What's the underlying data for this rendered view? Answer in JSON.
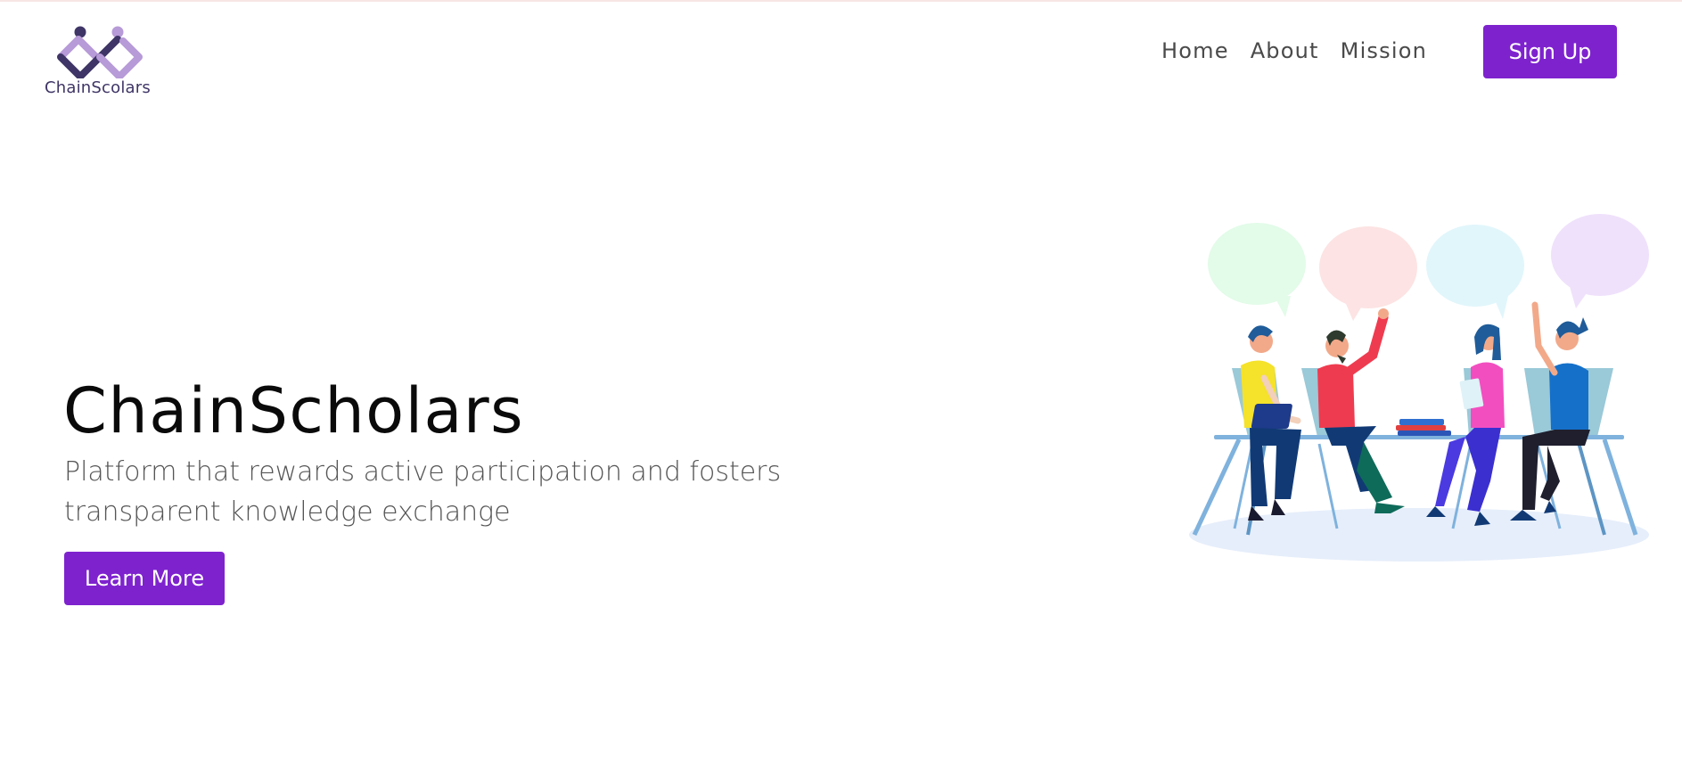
{
  "brand": {
    "logo_text": "ChainScolars",
    "colors": {
      "dark": "#3f3566",
      "light": "#b79ad8"
    }
  },
  "nav": {
    "items": [
      {
        "label": "Home"
      },
      {
        "label": "About"
      },
      {
        "label": "Mission"
      }
    ],
    "signup_label": "Sign Up"
  },
  "hero": {
    "title": "ChainScholars",
    "subtitle": "Platform that rewards active participation and fosters transparent knowledge exchange",
    "cta_label": "Learn More"
  },
  "illustration": {
    "icon": "team-discussion-illustration",
    "bubble_colors": [
      "#e3fbe9",
      "#fde3e3",
      "#e1f6fb",
      "#efe1fb"
    ]
  },
  "theme": {
    "accent": "#7e22ce",
    "text_muted": "#555555",
    "nav_text": "#4a4a4a"
  }
}
